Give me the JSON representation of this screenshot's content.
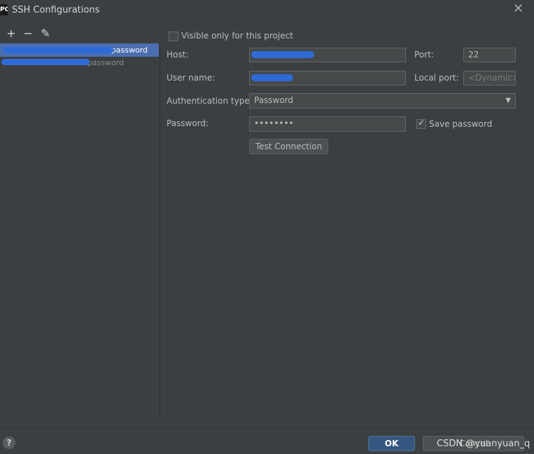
{
  "window": {
    "title": "SSH Configurations",
    "app_icon_text": "PC"
  },
  "toolbar": {
    "add": "+",
    "remove": "−",
    "edit": "✎"
  },
  "configs": [
    {
      "label": "password",
      "selected": true
    },
    {
      "label": "password",
      "selected": false
    }
  ],
  "form": {
    "visible_only_label": "Visible only for this project",
    "visible_only_checked": false,
    "host_label": "Host:",
    "host_value": "",
    "port_label": "Port:",
    "port_value": "22",
    "username_label": "User name:",
    "username_value": "",
    "local_port_label": "Local port:",
    "local_port_placeholder": "<Dynamic>",
    "auth_type_label": "Authentication type:",
    "auth_type_value": "Password",
    "password_label": "Password:",
    "password_value": "••••••••",
    "save_password_label": "Save password",
    "save_password_checked": true,
    "test_connection_label": "Test Connection"
  },
  "footer": {
    "help": "?",
    "ok_label": "OK",
    "cancel_label": "Cancel",
    "watermark": "CSDN @yuanyuan_q"
  }
}
